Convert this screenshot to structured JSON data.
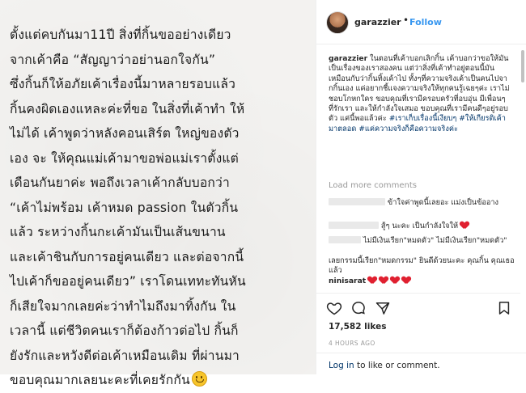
{
  "photo": {
    "lines": [
      "ตั้งแต่คบกันมา11ปี สิ่งที่กิ้นขออย่างเดียว",
      "จากเค้าคือ “สัญญาว่าอย่านอกใจกัน”",
      "ซึ่งกิ้นก็ให้อภัยเค้าเรื่องนี้มาหลายรอบแล้ว",
      "กิ้นคงผิดเองแหละค่ะที่ขอ ในสิ่งที่เค้าทำ ให้",
      "ไม่ได้ เค้าพูดว่าหลังคอนเสิร์ต ใหญ่ของตัว",
      "เอง จะ ให้คุณแม่เค้ามาขอพ่อแม่เราตั้งแต่",
      "เดือนกันยาค่ะ พอถึงเวลาเค้ากลับบอกว่า",
      "“เค้าไม่พร้อม เค้าหมด passion ในตัวกิ้น",
      "แล้ว ระหว่างกิ้นกะเค้ามันเป็นเส้นขนาน",
      "และเค้าชินกับการอยู่คนเดียว และต่อจากนี้",
      "ไปเค้าก็ขออยู่คนเดียว” เราโดนเททะทันหัน",
      "ก็เสียใจมากเลยค่ะว่าทำไมถึงมาทิ้งกัน ใน",
      "เวลานี้ แต่ชีวิตคนเราก็ต้องก้าวต่อไป กิ้นก็",
      "ยังรักและหวังดีต่อเค้าเหมือนเดิม ที่ผ่านมา",
      "ขอบคุณมากเลยนะคะที่เคยรักกัน"
    ],
    "emoji_icon": "smiley-emoji-icon"
  },
  "header": {
    "username": "garazzier",
    "separator": "•",
    "follow_label": "Follow"
  },
  "caption": {
    "username": "garazzier",
    "text": " ในตอนที่เค้าบอกเลิกกิ้น เค้าบอกว่าขอให้มันเป็นเรื่องของเราสองคน แต่ว่าสิ่งที่เค้าทำอยู่ตอนนี้มันเหมือนกับว่ากิ้นทิ้งเค้าไป ทั้งๆที่ความจริงเค้าเป็นคนไปจากกิ้นเอง แค่อยากชี้แจงความจริงให้ทุกคนรู้เฉยๆค่ะ เราไม่ชอบโกหกใคร ขอบคุณที่เรามีครอบครัวที่อบอุ่น มีเพื่อนๆที่รักเรา และให้กำลังใจเสมอ ขอบคุณที่เรามีคนดีๆอยู่รอบตัว แค่นี้พอแล้วค่ะ ",
    "hashtags": "#เราเก็บเรื่องนี้เงียบๆ #ให้เกียรติเค้ามาตลอด #แค่ความจริงก็คือความจริงค่ะ"
  },
  "load_more": "Load more comments",
  "comments": [
    {
      "text": "ข้าใจค่าพูดนี้เลยอะ แม่งเป็นข้ออาง"
    },
    {
      "text": "สู้ๆ นะคะ เป็นกำลังใจให้"
    },
    {
      "text": "ไม่มีเงินเรียก\"หมดตัว\" ไม่มีเงินเรียก\"หมดตัว\""
    },
    {
      "text": "เลยกรรมนี้เรียก\"หมดกรรม\" ยินดีด้วยนะคะ คุณกิ้น คุณเธอแล้ว"
    },
    {
      "username": "ninisarat",
      "hearts": 4
    }
  ],
  "likes": "17,582 likes",
  "timestamp": "4 HOURS AGO",
  "footer": {
    "login_label": "Log in",
    "rest": " to like or comment."
  },
  "colors": {
    "link": "#3897f0",
    "hashtag": "#003569",
    "heart": "#e02030"
  },
  "icons": [
    "heart-outline-icon",
    "comment-icon",
    "share-icon",
    "bookmark-icon"
  ]
}
